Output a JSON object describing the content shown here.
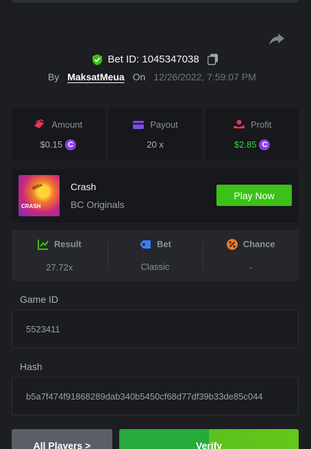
{
  "header": {
    "bet_id_label": "Bet ID: 1045347038",
    "by_label": "By",
    "username": "MaksatMeua",
    "on_label": "On",
    "datetime": "12/26/2022, 7:59:07 PM"
  },
  "summary": {
    "amount_label": "Amount",
    "amount_value": "$0.15",
    "payout_label": "Payout",
    "payout_value": "20 x",
    "profit_label": "Profit",
    "profit_value": "$2.85",
    "coin_symbol": "C"
  },
  "game": {
    "thumb_label": "CRASH",
    "thumb_badge": "999x",
    "name": "Crash",
    "provider": "BC Originals",
    "play_label": "Play Now"
  },
  "stats": {
    "result_label": "Result",
    "result_value": "27.72x",
    "bet_label": "Bet",
    "bet_value": "Classic",
    "chance_label": "Chance",
    "chance_value": "-"
  },
  "fields": {
    "game_id_label": "Game ID",
    "game_id_value": "5523411",
    "hash_label": "Hash",
    "hash_value": "b5a7f474f91868289dab340b5450cf68d77df39b33de85c044"
  },
  "actions": {
    "all_players_label": "All Players >",
    "verify_label": "Verify"
  },
  "colors": {
    "accent_green": "#3bc117",
    "profit_green": "#3bd33b",
    "coin_purple": "#8a3ff0"
  }
}
